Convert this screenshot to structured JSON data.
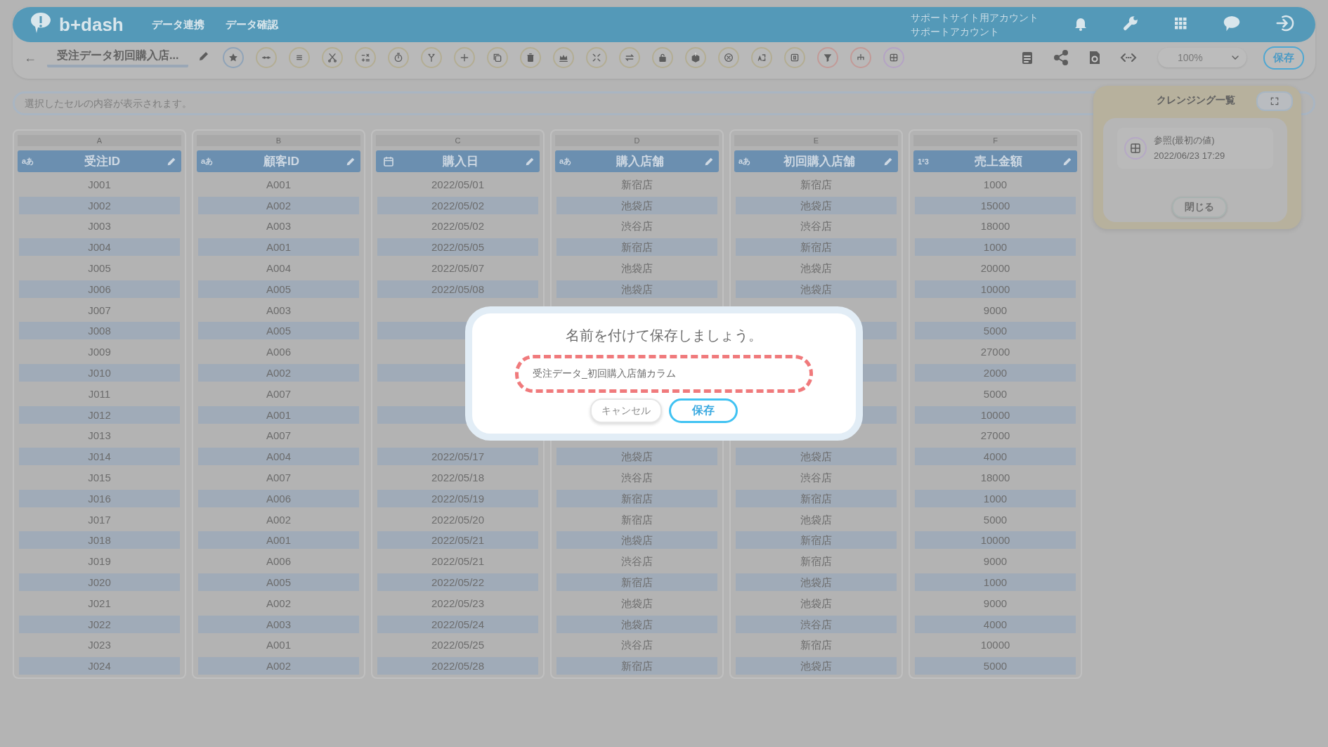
{
  "header": {
    "logo": "b+dash",
    "nav": [
      "データ連携",
      "データ確認"
    ],
    "account": [
      "サポートサイト用アカウント",
      "サポートアカウント"
    ]
  },
  "toolbar": {
    "back": "←",
    "title": "受注データ初回購入店...",
    "zoom": "100%",
    "save": "保存"
  },
  "cell_viewer": {
    "placeholder": "選択したセルの内容が表示されます。"
  },
  "columns": [
    {
      "letter": "A",
      "kind": "text",
      "type_label": "aあ",
      "name": "受注ID"
    },
    {
      "letter": "B",
      "kind": "text",
      "type_label": "aあ",
      "name": "顧客ID"
    },
    {
      "letter": "C",
      "kind": "date",
      "name": "購入日"
    },
    {
      "letter": "D",
      "kind": "text",
      "type_label": "aあ",
      "name": "購入店舗"
    },
    {
      "letter": "E",
      "kind": "text",
      "type_label": "aあ",
      "name": "初回購入店舗"
    },
    {
      "letter": "F",
      "kind": "number",
      "type_label": "1²3",
      "name": "売上金額"
    }
  ],
  "rows": [
    [
      "J001",
      "A001",
      "2022/05/01",
      "新宿店",
      "新宿店",
      "1000"
    ],
    [
      "J002",
      "A002",
      "2022/05/02",
      "池袋店",
      "池袋店",
      "15000"
    ],
    [
      "J003",
      "A003",
      "2022/05/02",
      "渋谷店",
      "渋谷店",
      "18000"
    ],
    [
      "J004",
      "A001",
      "2022/05/05",
      "新宿店",
      "新宿店",
      "1000"
    ],
    [
      "J005",
      "A004",
      "2022/05/07",
      "池袋店",
      "池袋店",
      "20000"
    ],
    [
      "J006",
      "A005",
      "2022/05/08",
      "池袋店",
      "池袋店",
      "10000"
    ],
    [
      "J007",
      "A003",
      null,
      null,
      null,
      "9000"
    ],
    [
      "J008",
      "A005",
      null,
      null,
      null,
      "5000"
    ],
    [
      "J009",
      "A006",
      null,
      null,
      null,
      "27000"
    ],
    [
      "J010",
      "A002",
      null,
      null,
      null,
      "2000"
    ],
    [
      "J011",
      "A007",
      null,
      null,
      null,
      "5000"
    ],
    [
      "J012",
      "A001",
      null,
      null,
      null,
      "10000"
    ],
    [
      "J013",
      "A007",
      null,
      null,
      null,
      "27000"
    ],
    [
      "J014",
      "A004",
      "2022/05/17",
      "池袋店",
      "池袋店",
      "4000"
    ],
    [
      "J015",
      "A007",
      "2022/05/18",
      "渋谷店",
      "渋谷店",
      "18000"
    ],
    [
      "J016",
      "A006",
      "2022/05/19",
      "新宿店",
      "新宿店",
      "1000"
    ],
    [
      "J017",
      "A002",
      "2022/05/20",
      "新宿店",
      "池袋店",
      "5000"
    ],
    [
      "J018",
      "A001",
      "2022/05/21",
      "池袋店",
      "新宿店",
      "10000"
    ],
    [
      "J019",
      "A006",
      "2022/05/21",
      "渋谷店",
      "新宿店",
      "9000"
    ],
    [
      "J020",
      "A005",
      "2022/05/22",
      "新宿店",
      "池袋店",
      "1000"
    ],
    [
      "J021",
      "A002",
      "2022/05/23",
      "池袋店",
      "池袋店",
      "9000"
    ],
    [
      "J022",
      "A003",
      "2022/05/24",
      "池袋店",
      "渋谷店",
      "4000"
    ],
    [
      "J023",
      "A001",
      "2022/05/25",
      "渋谷店",
      "新宿店",
      "10000"
    ],
    [
      "J024",
      "A002",
      "2022/05/28",
      "新宿店",
      "池袋店",
      "5000"
    ]
  ],
  "cleansing_panel": {
    "title": "クレンジング一覧",
    "items": [
      {
        "title": "参照(最初の値)",
        "time": "2022/06/23 17:29"
      }
    ],
    "close": "閉じる"
  },
  "save_dialog": {
    "title": "名前を付けて保存しましょう。",
    "value": "受注データ_初回購入店舗カラム",
    "cancel": "キャンセル",
    "save": "保存"
  }
}
